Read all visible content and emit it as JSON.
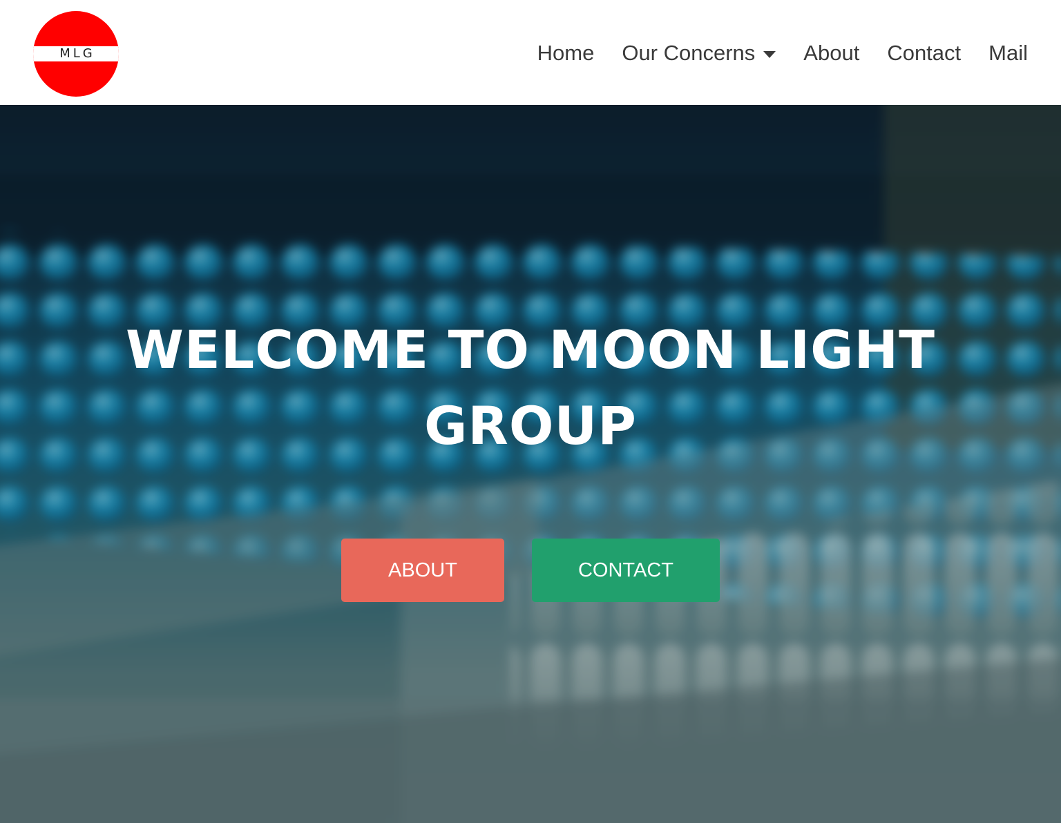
{
  "logo": {
    "text": "MLG"
  },
  "nav": {
    "items": [
      {
        "label": "Home"
      },
      {
        "label": "Our Concerns"
      },
      {
        "label": "About"
      },
      {
        "label": "Contact"
      },
      {
        "label": "Mail"
      }
    ]
  },
  "hero": {
    "title": "WELCOME TO MOON LIGHT GROUP",
    "buttons": {
      "about": "ABOUT",
      "contact": "CONTACT"
    }
  },
  "colors": {
    "logo_red": "#ff0000",
    "about_button": "#e8685a",
    "contact_button": "#21a06d",
    "nav_text": "#3a3a3a"
  },
  "icons": {
    "dropdown": "caret-down-icon"
  }
}
